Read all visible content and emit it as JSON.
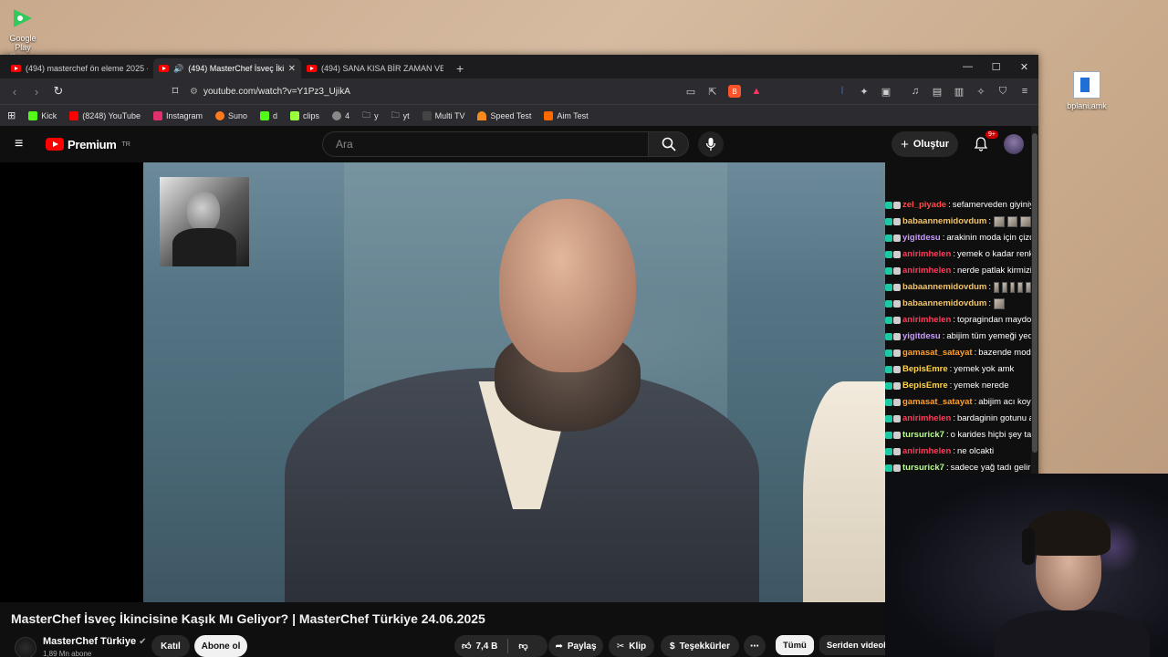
{
  "desktop": {
    "google_play_label": "Google Play Games",
    "bplani_label": "bplani.amk"
  },
  "browser": {
    "tabs": [
      {
        "label": "(494) masterchef ön eleme 2025 - Yo",
        "active": false,
        "audio": false
      },
      {
        "label": "(494) MasterChef İsveç İkincis",
        "active": true,
        "audio": true
      },
      {
        "label": "(494) SANA KISA BİR ZAMAN VERİYO",
        "active": false,
        "audio": false
      }
    ],
    "url": "youtube.com/watch?v=Y1Pz3_UjikA",
    "bookmarks": [
      {
        "label": "Kick",
        "color": "#53fc18"
      },
      {
        "label": "(8248) YouTube",
        "color": "#ff0000"
      },
      {
        "label": "Instagram",
        "color": "#e1306c"
      },
      {
        "label": "Suno",
        "color": "#ff7a1a"
      },
      {
        "label": "d",
        "color": "#53fc18"
      },
      {
        "label": "clips",
        "color": "#9aff3c"
      },
      {
        "label": "4",
        "color": "#888888"
      },
      {
        "label": "y",
        "color": "#888888"
      },
      {
        "label": "yt",
        "color": "#888888"
      },
      {
        "label": "Multi TV",
        "color": "#444444"
      },
      {
        "label": "Speed Test",
        "color": "#f68a1e"
      },
      {
        "label": "Aim Test",
        "color": "#ff6a00"
      }
    ]
  },
  "youtube": {
    "logo_text": "Premium",
    "logo_region": "TR",
    "search_placeholder": "Ara",
    "create_label": "Oluştur",
    "notification_count": "9+",
    "video_title": "MasterChef İsveç İkincisine Kaşık Mı Geliyor? | MasterChef Türkiye 24.06.2025",
    "channel_name": "MasterChef Türkiye",
    "channel_subs": "1,89 Mn abone",
    "join_label": "Katıl",
    "subscribe_label": "Abone ol",
    "like_count": "7,4 B",
    "share_label": "Paylaş",
    "clip_label": "Klip",
    "thanks_label": "Teşekkürler",
    "chips": [
      "Tümü",
      "Seriden videolar"
    ]
  },
  "chat": [
    {
      "user": "zel_piyade",
      "color": "#ff4b4b",
      "msg": "sefamerveden giyiniyor",
      "emotes": 0
    },
    {
      "user": "babaannemidovdum",
      "color": "#f4c56a",
      "msg": "",
      "emotes": 3
    },
    {
      "user": "yigitdesu",
      "color": "#c99bff",
      "msg": "arakinin moda için çizdiği kıyafetlerden alıyor",
      "emotes": 0
    },
    {
      "user": "anirimhelen",
      "color": "#ff3b5b",
      "msg": "yemek o kadar renksiz gozukuoki istetmedi",
      "emotes": 0
    },
    {
      "user": "anirimhelen",
      "color": "#ff3b5b",
      "msg": "nerde patlak kirmizi soslar",
      "emotes": 0
    },
    {
      "user": "babaannemidovdum",
      "color": "#f4c56a",
      "msg": "",
      "emotes": 5
    },
    {
      "user": "babaannemidovdum",
      "color": "#f4c56a",
      "msg": "",
      "emotes": 1
    },
    {
      "user": "anirimhelen",
      "color": "#ff3b5b",
      "msg": "topragindan maydonoz",
      "emotes": 0
    },
    {
      "user": "yigitdesu",
      "color": "#c99bff",
      "msg": "abijim tüm yemeği yediler bana kalmadi",
      "emotes": 0
    },
    {
      "user": "gamasat_satayat",
      "color": "#ff9f2e",
      "msg": "bazende moda",
      "emotes": 0
    },
    {
      "user": "BepisEmre",
      "color": "#ffd34e",
      "msg": "yemek yok amk",
      "emotes": 0
    },
    {
      "user": "BepisEmre",
      "color": "#ffd34e",
      "msg": "yemek nerede",
      "emotes": 0
    },
    {
      "user": "gamasat_satayat",
      "color": "#ff9f2e",
      "msg": "abijim acı koymayın ya",
      "emotes": 0
    },
    {
      "user": "anirimhelen",
      "color": "#ff3b5b",
      "msg": "bardaginin gotunu acik birakmissin",
      "emotes": 0
    },
    {
      "user": "tursurick7",
      "color": "#b6ff8a",
      "msg": "o karides hiçbi şey tatmıyodur",
      "emotes": 0
    },
    {
      "user": "anirimhelen",
      "color": "#ff3b5b",
      "msg": "ne olcakti",
      "emotes": 0
    },
    {
      "user": "tursurick7",
      "color": "#b6ff8a",
      "msg": "sadece yağ tadı gelir",
      "emotes": 0
    }
  ]
}
